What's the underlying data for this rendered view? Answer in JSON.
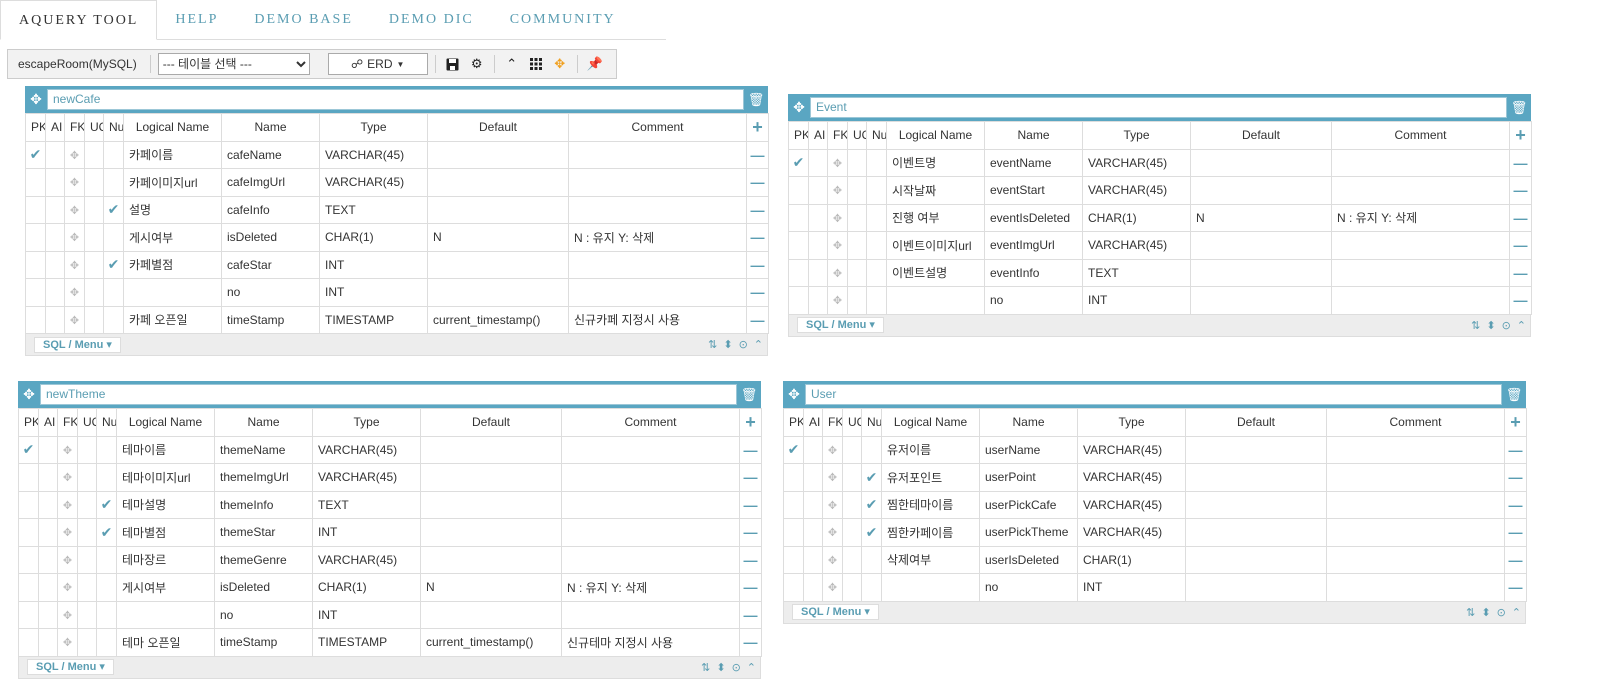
{
  "nav": {
    "tabs": [
      {
        "label": "AQUERY TOOL",
        "active": true
      },
      {
        "label": "HELP"
      },
      {
        "label": "DEMO BASE"
      },
      {
        "label": "DEMO DIC"
      },
      {
        "label": "COMMUNITY"
      }
    ]
  },
  "toolbar": {
    "db_name": "escapeRoom(MySQL)",
    "table_select": "--- 테이블 선택 ---",
    "erd_label": "ERD",
    "icons": [
      "save-icon",
      "gear-icon",
      "collapse-icon",
      "grid-icon",
      "move-icon",
      "pin-icon"
    ]
  },
  "colors": {
    "accent": "#5aa6c2",
    "orange": "#f0a020",
    "header_text": "#5a9db2"
  },
  "headers": {
    "pk": "PK",
    "ai": "AI",
    "fk": "FK",
    "uq": "UQ",
    "null": "Null",
    "logical": "Logical Name",
    "name": "Name",
    "type": "Type",
    "default": "Default",
    "comment": "Comment"
  },
  "footer": {
    "sql_menu": "SQL / Menu"
  },
  "tables": [
    {
      "name": "newCafe",
      "rows": [
        {
          "pk": true,
          "nul": false,
          "logical": "카페이름",
          "name": "cafeName",
          "type": "VARCHAR(45)",
          "default": "",
          "comment": ""
        },
        {
          "pk": false,
          "nul": false,
          "logical": "카페이미지url",
          "name": "cafeImgUrl",
          "type": "VARCHAR(45)",
          "default": "",
          "comment": ""
        },
        {
          "pk": false,
          "nul": true,
          "logical": "설명",
          "name": "cafeInfo",
          "type": "TEXT",
          "default": "",
          "comment": ""
        },
        {
          "pk": false,
          "nul": false,
          "logical": "게시여부",
          "name": "isDeleted",
          "type": "CHAR(1)",
          "default": "N",
          "comment": "N : 유지 Y:  삭제"
        },
        {
          "pk": false,
          "nul": true,
          "logical": "카페별점",
          "name": "cafeStar",
          "type": "INT",
          "default": "",
          "comment": ""
        },
        {
          "pk": false,
          "nul": false,
          "logical": "",
          "name": "no",
          "type": "INT",
          "default": "",
          "comment": ""
        },
        {
          "pk": false,
          "nul": false,
          "logical": "카페 오픈일",
          "name": "timeStamp",
          "type": "TIMESTAMP",
          "default": "current_timestamp()",
          "comment": "신규카페 지정시 사용"
        }
      ]
    },
    {
      "name": "Event",
      "rows": [
        {
          "pk": true,
          "nul": false,
          "logical": "이벤트명",
          "name": "eventName",
          "type": "VARCHAR(45)",
          "default": "",
          "comment": ""
        },
        {
          "pk": false,
          "nul": false,
          "logical": "시작날짜",
          "name": "eventStart",
          "type": "VARCHAR(45)",
          "default": "",
          "comment": ""
        },
        {
          "pk": false,
          "nul": false,
          "logical": "진행 여부",
          "name": "eventIsDeleted",
          "type": "CHAR(1)",
          "default": "N",
          "comment": "N : 유지 Y:  삭제"
        },
        {
          "pk": false,
          "nul": false,
          "logical": "이벤트이미지url",
          "name": "eventImgUrl",
          "type": "VARCHAR(45)",
          "default": "",
          "comment": ""
        },
        {
          "pk": false,
          "nul": false,
          "logical": "이벤트설명",
          "name": "eventInfo",
          "type": "TEXT",
          "default": "",
          "comment": ""
        },
        {
          "pk": false,
          "nul": false,
          "logical": "",
          "name": "no",
          "type": "INT",
          "default": "",
          "comment": ""
        }
      ]
    },
    {
      "name": "newTheme",
      "rows": [
        {
          "pk": true,
          "nul": false,
          "logical": "테마이름",
          "name": "themeName",
          "type": "VARCHAR(45)",
          "default": "",
          "comment": ""
        },
        {
          "pk": false,
          "nul": false,
          "logical": "테마이미지url",
          "name": "themeImgUrl",
          "type": "VARCHAR(45)",
          "default": "",
          "comment": ""
        },
        {
          "pk": false,
          "nul": true,
          "logical": "테마설명",
          "name": "themeInfo",
          "type": "TEXT",
          "default": "",
          "comment": ""
        },
        {
          "pk": false,
          "nul": true,
          "logical": "테마별점",
          "name": "themeStar",
          "type": "INT",
          "default": "",
          "comment": ""
        },
        {
          "pk": false,
          "nul": false,
          "logical": "테마장르",
          "name": "themeGenre",
          "type": "VARCHAR(45)",
          "default": "",
          "comment": ""
        },
        {
          "pk": false,
          "nul": false,
          "logical": "게시여부",
          "name": "isDeleted",
          "type": "CHAR(1)",
          "default": "N",
          "comment": "N : 유지 Y:  삭제"
        },
        {
          "pk": false,
          "nul": false,
          "logical": "",
          "name": "no",
          "type": "INT",
          "default": "",
          "comment": ""
        },
        {
          "pk": false,
          "nul": false,
          "logical": "테마 오픈일",
          "name": "timeStamp",
          "type": "TIMESTAMP",
          "default": "current_timestamp()",
          "comment": "신규테마 지정시 사용"
        }
      ]
    },
    {
      "name": "User",
      "rows": [
        {
          "pk": true,
          "nul": false,
          "logical": "유저이름",
          "name": "userName",
          "type": "VARCHAR(45)",
          "default": "",
          "comment": ""
        },
        {
          "pk": false,
          "nul": true,
          "logical": "유저포인트",
          "name": "userPoint",
          "type": "VARCHAR(45)",
          "default": "",
          "comment": ""
        },
        {
          "pk": false,
          "nul": true,
          "logical": "찜한테마이름",
          "name": "userPickCafe",
          "type": "VARCHAR(45)",
          "default": "",
          "comment": ""
        },
        {
          "pk": false,
          "nul": true,
          "logical": "찜한카페이름",
          "name": "userPickTheme",
          "type": "VARCHAR(45)",
          "default": "",
          "comment": ""
        },
        {
          "pk": false,
          "nul": false,
          "logical": "삭제여부",
          "name": "userIsDeleted",
          "type": "CHAR(1)",
          "default": "",
          "comment": ""
        },
        {
          "pk": false,
          "nul": false,
          "logical": "",
          "name": "no",
          "type": "INT",
          "default": "",
          "comment": ""
        }
      ]
    }
  ]
}
